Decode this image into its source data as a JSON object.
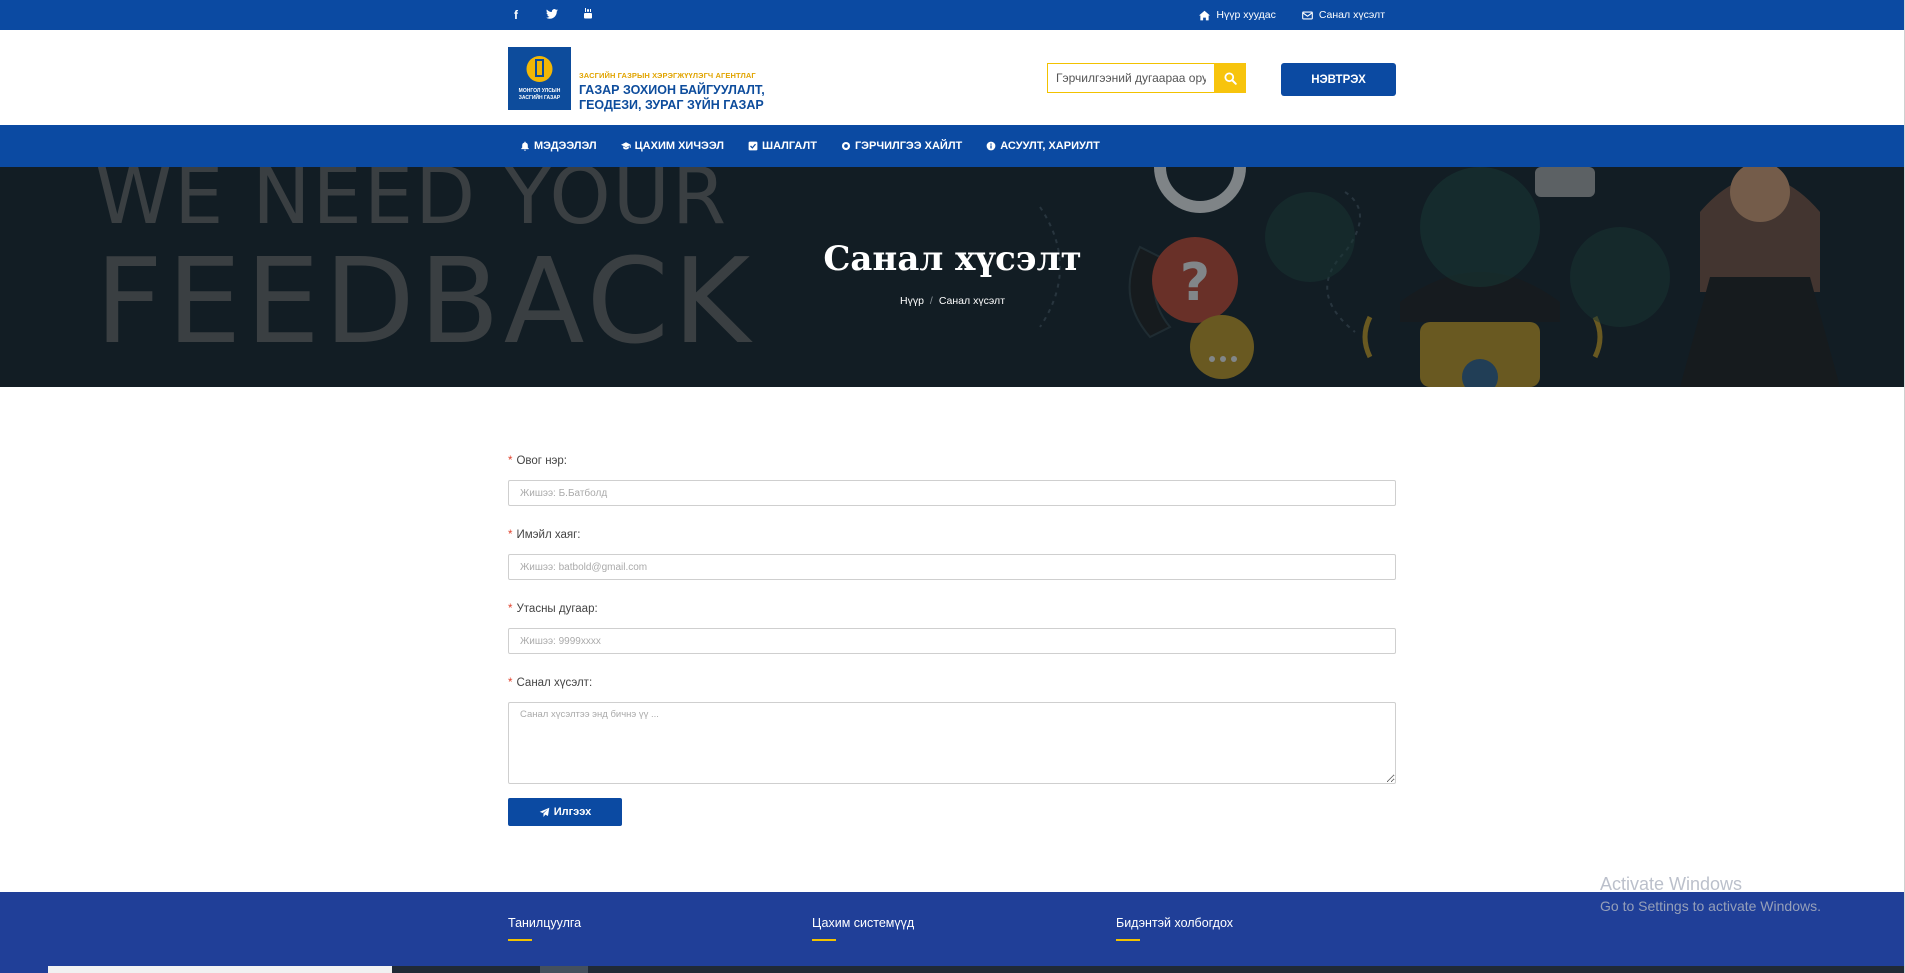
{
  "topbar": {
    "social": [
      "f",
      "twitter-icon",
      "youtube-icon"
    ],
    "links": [
      {
        "label": "Нүүр хуудас",
        "icon": "home-icon"
      },
      {
        "label": "Санал хүсэлт",
        "icon": "envelope-icon"
      }
    ]
  },
  "header": {
    "logo_line1": "ЗАСГИЙН ГАЗРЫН ХЭРЭГЖҮҮЛЭГЧ АГЕНТЛАГ",
    "logo_line2": "ГАЗАР ЗОХИОН БАЙГУУЛАЛТ,",
    "logo_line3": "ГЕОДЕЗИ, ЗУРАГ ЗҮЙН ГАЗАР",
    "logo_emblem_text": "МОНГОЛ УЛСЫН ЗАСГИЙН ГАЗАР",
    "search_placeholder": "Гэрчилгээний дугаараа оруулна уу",
    "login_label": "НЭВТРЭХ"
  },
  "nav": {
    "items": [
      {
        "label": "МЭДЭЭЛЭЛ",
        "icon": "bell-icon"
      },
      {
        "label": "ЦАХИМ ХИЧЭЭЛ",
        "icon": "graduation-cap-icon"
      },
      {
        "label": "ШАЛГАЛТ",
        "icon": "checkbox-icon"
      },
      {
        "label": "ГЭРЧИЛГЭЭ ХАЙЛТ",
        "icon": "certificate-icon"
      },
      {
        "label": "АСУУЛТ, ХАРИУЛТ",
        "icon": "info-icon"
      }
    ]
  },
  "hero": {
    "bg_text1": "WE NEED YOUR",
    "bg_text2": "FEEDBACK",
    "title": "Санал хүсэлт",
    "breadcrumb_home": "Нүүр",
    "breadcrumb_current": "Санал хүсэлт"
  },
  "form": {
    "fields": [
      {
        "label": "Овог нэр:",
        "placeholder": "Жишээ: Б.Батболд"
      },
      {
        "label": "Имэйл хаяг:",
        "placeholder": "Жишээ: batbold@gmail.com"
      },
      {
        "label": "Утасны дугаар:",
        "placeholder": "Жишээ: 9999xxxx"
      },
      {
        "label": "Санал хүсэлт:",
        "placeholder": "Санал хүсэлтээ энд бичнэ үү ..."
      }
    ],
    "required_mark": "*",
    "submit_label": "Илгээх"
  },
  "footer": {
    "columns": [
      "Танилцуулга",
      "Цахим системүүд",
      "Бидэнтэй холбогдох"
    ]
  },
  "windows": {
    "line1": "Activate Windows",
    "line2": "Go to Settings to activate Windows."
  },
  "colors": {
    "primary": "#0b4aa2",
    "accent": "#f7c40d",
    "footer": "#203f98",
    "required": "#e0452f"
  }
}
